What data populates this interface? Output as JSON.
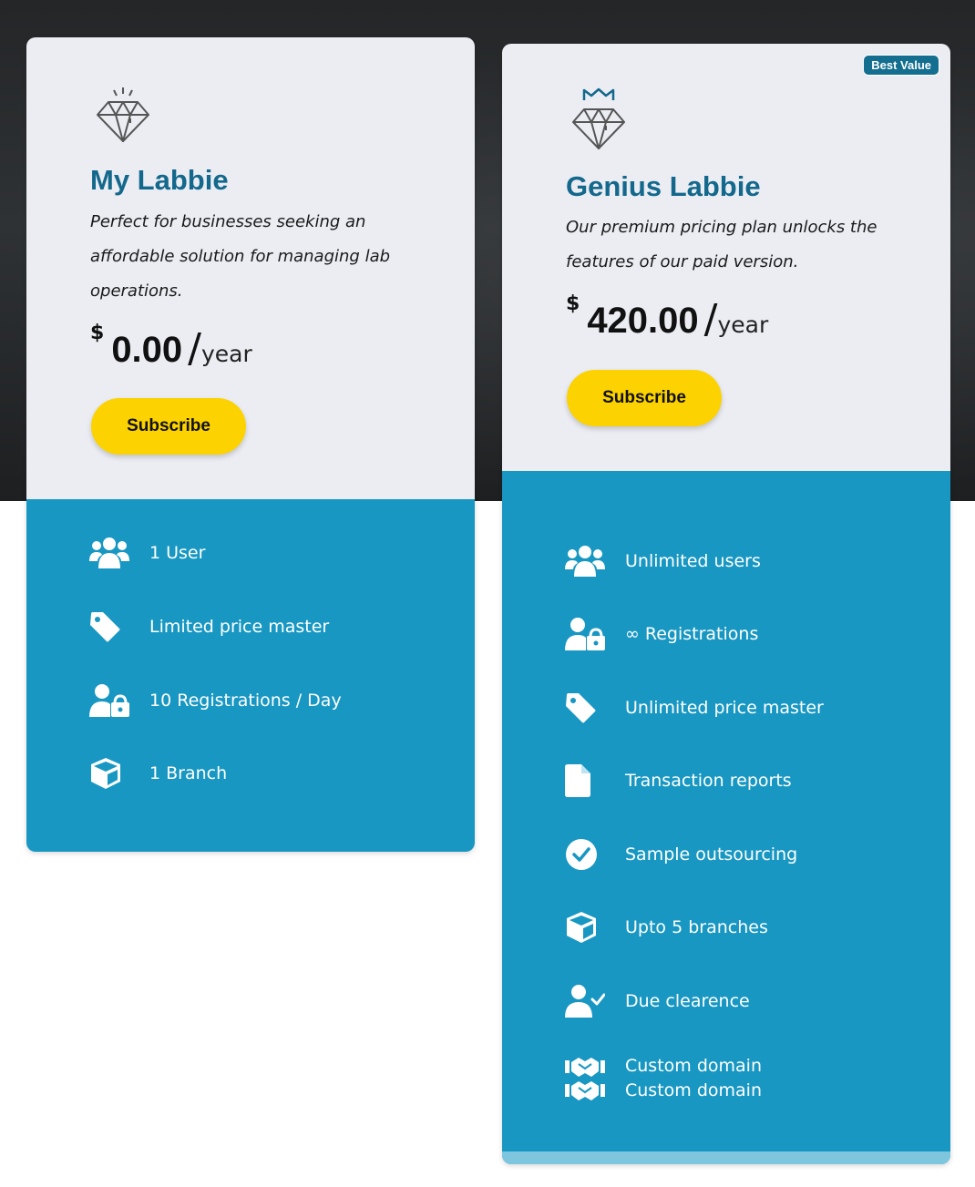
{
  "plans": [
    {
      "title": "My Labbie",
      "description": "Perfect for businesses seeking an affordable solution for managing lab operations.",
      "currency": "$",
      "price": "0.00",
      "slash": "/",
      "period": "year",
      "button_label": "Subscribe",
      "icon": "diamond-icon",
      "features": [
        {
          "icon": "users-icon",
          "label": "1 User"
        },
        {
          "icon": "tag-icon",
          "label": "Limited price master"
        },
        {
          "icon": "user-lock-icon",
          "label": "10 Registrations / Day"
        },
        {
          "icon": "box-icon",
          "label": "1 Branch"
        }
      ]
    },
    {
      "title": "Genius Labbie",
      "badge": "Best Value",
      "description": "Our premium pricing plan unlocks the features of our paid version.",
      "currency": "$",
      "price": "420.00",
      "slash": "/",
      "period": "year",
      "button_label": "Subscribe",
      "icon": "crown-diamond-icon",
      "features": [
        {
          "icon": "users-icon",
          "label": "Unlimited users"
        },
        {
          "icon": "user-lock-icon",
          "label": "∞ Registrations"
        },
        {
          "icon": "tag-icon",
          "label": "Unlimited price master"
        },
        {
          "icon": "file-icon",
          "label": "Transaction reports"
        },
        {
          "icon": "check-circle-icon",
          "label": "Sample outsourcing"
        },
        {
          "icon": "box-icon",
          "label": "Upto 5 branches"
        },
        {
          "icon": "user-check-icon",
          "label": "Due clearence"
        },
        {
          "icon": "handshake-icon",
          "label": "Custom domain",
          "label2": "Custom domain"
        }
      ]
    }
  ],
  "colors": {
    "title": "#13688c",
    "features_bg": "#1897c3",
    "button": "#fcd200",
    "card_top": "#ebedf3",
    "badge": "#136e8f"
  }
}
